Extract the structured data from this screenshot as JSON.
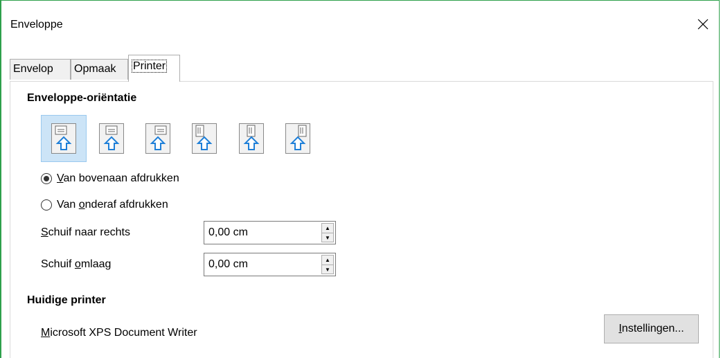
{
  "window": {
    "title": "Enveloppe"
  },
  "tabs": [
    {
      "label": "Envelop",
      "active": false
    },
    {
      "label": "Opmaak",
      "active": false
    },
    {
      "label": "Printer",
      "active": true
    }
  ],
  "orientation": {
    "heading": "Enveloppe-oriëntatie",
    "options": [
      {
        "icon": "envelope-horizontal-left-icon",
        "selected": true
      },
      {
        "icon": "envelope-horizontal-center-icon",
        "selected": false
      },
      {
        "icon": "envelope-horizontal-right-icon",
        "selected": false
      },
      {
        "icon": "envelope-vertical-left-icon",
        "selected": false
      },
      {
        "icon": "envelope-vertical-center-icon",
        "selected": false
      },
      {
        "icon": "envelope-vertical-right-icon",
        "selected": false
      }
    ]
  },
  "print_from": {
    "top": {
      "label_pre": "",
      "label_u": "V",
      "label_post": "an bovenaan afdrukken",
      "checked": true
    },
    "bottom": {
      "label_pre": "Van ",
      "label_u": "o",
      "label_post": "nderaf afdrukken",
      "checked": false
    }
  },
  "shift_right": {
    "label_u": "S",
    "label_post": "chuif naar rechts",
    "value": "0,00 cm"
  },
  "shift_down": {
    "label_pre": "Schuif ",
    "label_u": "o",
    "label_post": "mlaag",
    "value": "0,00 cm"
  },
  "printer": {
    "heading": "Huidige printer",
    "name_u": "M",
    "name_post": "icrosoft XPS Document Writer",
    "settings_u": "I",
    "settings_post": "nstellingen..."
  },
  "colors": {
    "selection": "#cce4f7",
    "window_border": "#2ea04b",
    "arrow": "#1e7fd8"
  }
}
